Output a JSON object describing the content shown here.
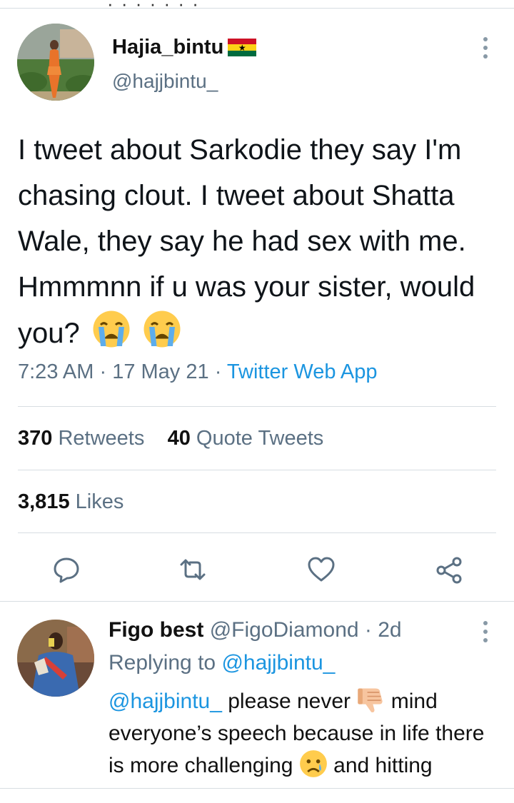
{
  "tweet": {
    "display_name": "Hajia_bintu",
    "handle": "@hajjbintu_",
    "text": "I tweet about Sarkodie they say I'm chasing clout. I tweet about Shatta Wale, they say he had sex with me. Hmmmnn if u was your sister, would you?",
    "time": "7:23 AM",
    "sep1": "·",
    "date": "17 May 21",
    "sep2": "·",
    "source": "Twitter Web App",
    "retweets_count": "370",
    "retweets_label": "Retweets",
    "quotes_count": "40",
    "quotes_label": "Quote Tweets",
    "likes_count": "3,815",
    "likes_label": "Likes"
  },
  "reply": {
    "display_name": "Figo best",
    "handle": "@FigoDiamond",
    "sep": "·",
    "age": "2d",
    "replying_prefix": "Replying to",
    "replying_to": "@hajjbintu_",
    "mention": "@hajjbintu_",
    "text_a": "please never",
    "text_b": "mind everyone’s speech because in life there is more challenging",
    "text_c": "and hitting"
  },
  "icons": [
    "ghana-flag-icon",
    "more-icon",
    "crying-face-emoji",
    "reply-icon",
    "retweet-icon",
    "like-icon",
    "share-icon",
    "thumbs-down-emoji",
    "sad-face-emoji"
  ],
  "colors": {
    "link": "#1b95e0",
    "secondary_text": "#5b7083",
    "divider": "#d7dde2",
    "emoji_yellow": "#ffcc4d",
    "tear_blue": "#5dadec"
  }
}
